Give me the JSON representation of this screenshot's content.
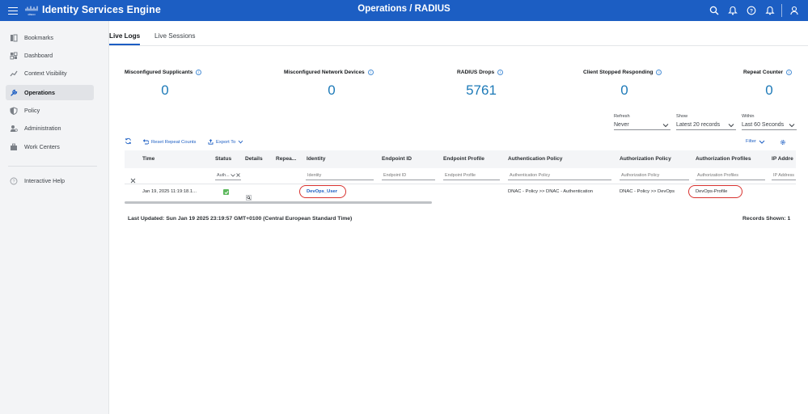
{
  "header": {
    "app_title": "Identity Services Engine",
    "page_title": "Operations / RADIUS",
    "logo_text": "cisco",
    "icons": [
      "search-icon",
      "notifications-icon",
      "help-icon",
      "bell-icon",
      "user-icon"
    ]
  },
  "sidebar": {
    "items": [
      {
        "label": "Bookmarks",
        "icon": "bookmarks-icon"
      },
      {
        "label": "Dashboard",
        "icon": "dashboard-icon"
      },
      {
        "label": "Context Visibility",
        "icon": "context-visibility-icon"
      },
      {
        "label": "Operations",
        "icon": "operations-icon",
        "active": true
      },
      {
        "label": "Policy",
        "icon": "policy-icon"
      },
      {
        "label": "Administration",
        "icon": "administration-icon"
      },
      {
        "label": "Work Centers",
        "icon": "work-centers-icon"
      }
    ],
    "help": {
      "label": "Interactive Help",
      "icon": "help-icon"
    }
  },
  "tabs": [
    {
      "label": "Live Logs",
      "active": true
    },
    {
      "label": "Live Sessions"
    }
  ],
  "stats": [
    {
      "label": "Misconfigured Supplicants",
      "value": "0"
    },
    {
      "label": "Misconfigured Network Devices",
      "value": "0"
    },
    {
      "label": "RADIUS Drops",
      "value": "5761"
    },
    {
      "label": "Client Stopped Responding",
      "value": "0"
    },
    {
      "label": "Repeat Counter",
      "value": "0"
    }
  ],
  "controls": {
    "refresh": {
      "label": "Refresh",
      "value": "Never"
    },
    "show": {
      "label": "Show",
      "value": "Latest 20 records"
    },
    "within": {
      "label": "Within",
      "value": "Last 60 Seconds"
    }
  },
  "toolbar": {
    "reset_label": "Reset Repeat Counts",
    "export_label": "Export To",
    "filter_label": "Filter"
  },
  "table": {
    "columns": [
      "Time",
      "Status",
      "Details",
      "Repea...",
      "Identity",
      "Endpoint ID",
      "Endpoint Profile",
      "Authentication Policy",
      "Authorization Policy",
      "Authorization Profiles",
      "IP Addre"
    ],
    "filters": {
      "status": "Auth...",
      "identity": "Identity",
      "endpoint_id": "Endpoint ID",
      "endpoint_profile": "Endpoint Profile",
      "authentication_policy": "Authentication Policy",
      "authorization_policy": "Authorization Policy",
      "authorization_profiles": "Authorization Profiles",
      "ip_address": "IP Address"
    },
    "rows": [
      {
        "time": "Jan 19, 2025 11:19:18.1...",
        "identity": "DevOps_User",
        "authentication_policy": "DNAC - Policy >> DNAC - Authentication",
        "authorization_policy": "DNAC - Policy >> DevOps",
        "authorization_profiles": "DevOps-Profile"
      }
    ]
  },
  "footer": {
    "last_updated": "Last Updated: Sun Jan 19 2025 23:19:57 GMT+0100 (Central European Standard Time)",
    "records_shown": "Records Shown: 1"
  },
  "colors": {
    "header_bg": "#1c5ec3",
    "stat_value": "#1d7ab8",
    "link": "#1c5ec3",
    "highlight": "#d8322f",
    "status_ok": "#5cb85c"
  }
}
